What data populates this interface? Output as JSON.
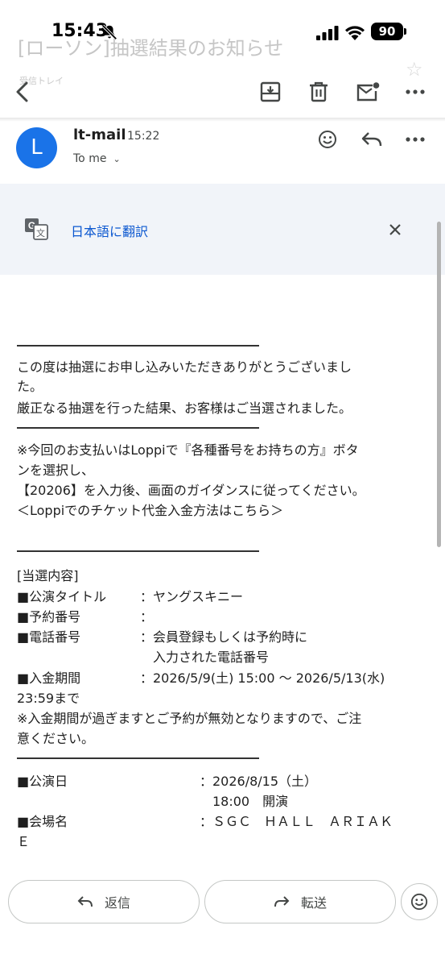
{
  "status_bar": {
    "time": "15:43",
    "battery": "90"
  },
  "ghost_header": {
    "subject": "[ローソン]抽選結果のお知らせ",
    "label": "受信トレイ"
  },
  "icons": {
    "back": "back-arrow-icon",
    "archive": "archive-icon",
    "delete": "trash-icon",
    "mark_unread": "mark-unread-icon",
    "more": "more-vert-icon",
    "emoji": "emoji-icon",
    "reply": "reply-icon",
    "translate": "translate-icon",
    "close": "close-icon",
    "forward": "forward-icon"
  },
  "email": {
    "avatar_letter": "L",
    "sender": "lt-mail",
    "time": "15:22",
    "to": "To me"
  },
  "translate_banner": {
    "label": "日本語に翻訳"
  },
  "body": {
    "p1_line1": "この度は抽選にお申し込みいただきありがとうございまし",
    "p1_line2": "た。",
    "p1_line3": "厳正なる抽選を行った結果、お客様はご当選されました。",
    "p2_line1": "※今回のお支払いはLoppiで『各種番号をお持ちの方』ボタ",
    "p2_line2": "ンを選択し、",
    "p2_line3": "【20206】を入力後、画面のガイダンスに従ってください。",
    "p2_link": "＜Loppiでのチケット代金入金方法はこちら＞",
    "section_title": "[当選内容]",
    "rows": [
      {
        "label": "■公演タイトル",
        "value": "：ヤングスキニー"
      },
      {
        "label": "■予約番号",
        "value": "："
      },
      {
        "label": "■電話番号",
        "value": "：会員登録もしくは予約時に"
      },
      {
        "label": "",
        "value": "入力された電話番号"
      },
      {
        "label": "■入金期間",
        "value": "：2026/5/9(土) 15:00 ～ 2026/5/13(水)"
      }
    ],
    "period_cont": "23:59まで",
    "notice_line1": "※入金期間が過ぎますとご予約が無効となりますので、ご注",
    "notice_line2": "意ください。",
    "rows2": [
      {
        "label": "■公演日",
        "value": "：2026/8/15（土）"
      },
      {
        "label": "",
        "value": "18:00　開演"
      },
      {
        "label": "■会場名",
        "value": "：ＳＧＣ　ＨＡＬＬ　ＡＲＩＡＫ"
      }
    ],
    "venue_cont": "Ｅ"
  },
  "actions": {
    "reply": "返信",
    "forward": "転送"
  }
}
